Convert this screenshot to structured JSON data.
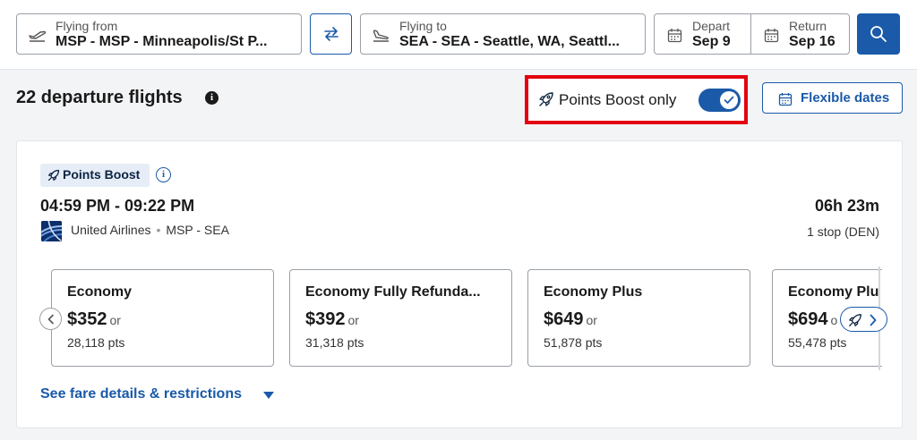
{
  "search": {
    "from_label": "Flying from",
    "from_value": "MSP - MSP - Minneapolis/St P...",
    "to_label": "Flying to",
    "to_value": "SEA - SEA - Seattle, WA, Seattl...",
    "depart_label": "Depart",
    "depart_value": "Sep 9",
    "return_label": "Return",
    "return_value": "Sep 16",
    "icons": [
      "plane-takeoff-icon",
      "swap-arrows-icon",
      "plane-landing-icon",
      "calendar-icon",
      "search-icon"
    ]
  },
  "results": {
    "title": "22 departure flights",
    "info_glyph": "i",
    "points_boost_toggle_label": "Points Boost only",
    "points_boost_toggle_on": true,
    "flexible_dates_label": "Flexible dates"
  },
  "flight": {
    "badge_label": "Points Boost",
    "badge_info_glyph": "i",
    "times": "04:59 PM - 09:22 PM",
    "airline": "United Airlines",
    "route": "MSP - SEA",
    "duration": "06h 23m",
    "stops": "1 stop (DEN)",
    "fares": [
      {
        "name": "Economy",
        "price": "$352",
        "or": "or",
        "points": "28,118 pts"
      },
      {
        "name": "Economy Fully Refunda...",
        "price": "$392",
        "or": "or",
        "points": "31,318 pts"
      },
      {
        "name": "Economy Plus",
        "price": "$649",
        "or": "or",
        "points": "51,878 pts"
      },
      {
        "name": "Economy Plu",
        "price": "$694",
        "or": "o",
        "points": "55,478 pts"
      }
    ],
    "fare_details_link": "See fare details & restrictions"
  },
  "colors": {
    "brand_blue": "#1a5aa8",
    "highlight_red": "#e3000f",
    "badge_bg": "#e6edf7"
  }
}
